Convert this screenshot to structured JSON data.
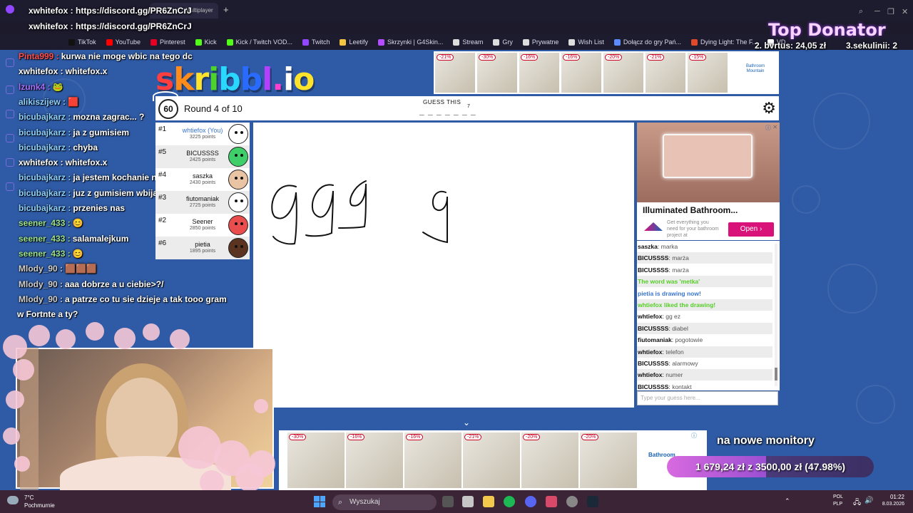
{
  "browser": {
    "tab_title": "Multiplayer",
    "url_overlay_1": "xwhitefox : https://discord.gg/PR6ZnCrJ",
    "url_overlay_2": "xwhitefox : https://discord.gg/PR6ZnCrJ",
    "bookmarks": [
      {
        "label": "TikTok",
        "color": "#111111"
      },
      {
        "label": "YouTube",
        "color": "#ff0000"
      },
      {
        "label": "Pinterest",
        "color": "#e60023"
      },
      {
        "label": "Kick",
        "color": "#53fc18"
      },
      {
        "label": "Kick / Twitch VOD...",
        "color": "#53fc18"
      },
      {
        "label": "Twitch",
        "color": "#9146ff"
      },
      {
        "label": "Leetify",
        "color": "#f5c542"
      },
      {
        "label": "Skrzynki | G4Skin...",
        "color": "#b44dff"
      },
      {
        "label": "Stream",
        "color": "#dddddd"
      },
      {
        "label": "Gry",
        "color": "#dddddd"
      },
      {
        "label": "Prywatne",
        "color": "#dddddd"
      },
      {
        "label": "Wish List",
        "color": "#dddddd"
      },
      {
        "label": "Dołącz do gry Pań...",
        "color": "#5b8cff"
      },
      {
        "label": "Dying Light: The F...",
        "color": "#e04a2a"
      },
      {
        "label": "VD",
        "color": "#ffffff"
      }
    ]
  },
  "stream_overlay": {
    "top_donator_title": "Top Donator",
    "donator_2": "2. bvrtus: 24,05 zł",
    "donator_3": "3.sekulinii: 2",
    "goal_text": "na nowe monitory",
    "goal_progress": "1 679,24 zł z 3500,00 zł (47.98%)",
    "goal_fraction": 0.4798
  },
  "twitch_chat": [
    {
      "user": "Pinta999",
      "user_color": "#ff4d4d",
      "msg": "kurwa nie moge wbic na tego dc"
    },
    {
      "user": "xwhitefox",
      "user_color": "#ffffff",
      "msg": "whitefox.x"
    },
    {
      "user": "lzunk4",
      "user_color": "#a970ff",
      "msg": "🐸"
    },
    {
      "user": "alikiszijew",
      "user_color": "#8fd3ff",
      "msg": "🟥"
    },
    {
      "user": "bicubajkarz",
      "user_color": "#8fd3ff",
      "msg": "mozna zagrac... ?"
    },
    {
      "user": "bicubajkarz",
      "user_color": "#8fd3ff",
      "msg": "ja z gumisiem"
    },
    {
      "user": "bicubajkarz",
      "user_color": "#8fd3ff",
      "msg": "chyba"
    },
    {
      "user": "xwhitefox",
      "user_color": "#ffffff",
      "msg": "whitefox.x"
    },
    {
      "user": "bicubajkarz",
      "user_color": "#8fd3ff",
      "msg": "ja jestem kochanie na dc"
    },
    {
      "user": "bicubajkarz",
      "user_color": "#8fd3ff",
      "msg": "juz z gumisiem wbijamy"
    },
    {
      "user": "bicubajkarz",
      "user_color": "#8fd3ff",
      "msg": "przenies nas"
    },
    {
      "user": "seener_433",
      "user_color": "#9be38c",
      "msg": "😊"
    },
    {
      "user": "seener_433",
      "user_color": "#9be38c",
      "msg": "salamalejkum"
    },
    {
      "user": "seener_433",
      "user_color": "#9be38c",
      "msg": "😊"
    },
    {
      "user": "Mlody_90",
      "user_color": "#cfcfcf",
      "msg": "🟫🟫🟫"
    },
    {
      "user": "Mlody_90",
      "user_color": "#cfcfcf",
      "msg": "aaa dobrze a u ciebie>?/"
    },
    {
      "user": "Mlody_90",
      "user_color": "#cfcfcf",
      "msg": "a patrze co tu sie dzieje a tak tooo gram"
    },
    {
      "user": "",
      "user_color": "#ffffff",
      "msg": "w Fortnte a ty?"
    }
  ],
  "game": {
    "logo": "skribbl.io",
    "timer": "60",
    "round_text": "Round 4 of 10",
    "guess_label": "GUESS THIS",
    "word_blank": "_ _ _ _ _ _ _",
    "word_length": "7",
    "players": [
      {
        "rank": "#1",
        "name": "whtiefox (You)",
        "points": "3225 points",
        "color": "#ffffff",
        "self": true
      },
      {
        "rank": "#5",
        "name": "BICUSSSS",
        "points": "2425 points",
        "color": "#3ecf6a",
        "self": false
      },
      {
        "rank": "#4",
        "name": "saszka",
        "points": "2430 points",
        "color": "#e8c3a4",
        "self": false
      },
      {
        "rank": "#3",
        "name": "fiutomaniak",
        "points": "2725 points",
        "color": "#ffffff",
        "self": false
      },
      {
        "rank": "#2",
        "name": "Seener",
        "points": "2850 points",
        "color": "#e94d4d",
        "self": false
      },
      {
        "rank": "#6",
        "name": "pietia",
        "points": "1895 points",
        "color": "#5a3420",
        "self": false
      }
    ],
    "chat": [
      {
        "user": "saszka",
        "msg": "marka",
        "color": "#111111",
        "system": false
      },
      {
        "user": "BICUSSSS",
        "msg": "marża",
        "color": "#111111",
        "system": false
      },
      {
        "user": "BICUSSSS",
        "msg": "marża",
        "color": "#111111",
        "system": false
      },
      {
        "user": "",
        "msg": "The word was 'metka'",
        "color": "#56ce27",
        "system": true
      },
      {
        "user": "",
        "msg": "pietia is drawing now!",
        "color": "#3975ce",
        "system": true
      },
      {
        "user": "",
        "msg": "whtiefox liked the drawing!",
        "color": "#56ce27",
        "system": true
      },
      {
        "user": "whtiefox",
        "msg": "gg ez",
        "color": "#111111",
        "system": false
      },
      {
        "user": "BICUSSSS",
        "msg": "diabel",
        "color": "#111111",
        "system": false
      },
      {
        "user": "fiutomaniak",
        "msg": "pogotowie",
        "color": "#111111",
        "system": false
      },
      {
        "user": "whtiefox",
        "msg": "telefon",
        "color": "#111111",
        "system": false
      },
      {
        "user": "BICUSSSS",
        "msg": "alarmowy",
        "color": "#111111",
        "system": false
      },
      {
        "user": "whtiefox",
        "msg": "numer",
        "color": "#111111",
        "system": false
      },
      {
        "user": "BICUSSSS",
        "msg": "kontakt",
        "color": "#111111",
        "system": false
      }
    ],
    "guess_placeholder": "Type your guess here..."
  },
  "ads": {
    "top_discounts": [
      "-21%",
      "-30%",
      "-16%",
      "-16%",
      "-20%",
      "-21%",
      "-15%"
    ],
    "top_brand": "Bathroom Mountain",
    "right_title": "Illuminated Bathroom...",
    "right_desc": "Get everything you need for your bathroom project at",
    "right_button": "Open",
    "bottom_discounts": [
      "-30%",
      "-16%",
      "-16%",
      "-21%",
      "-20%",
      "-20%"
    ],
    "bottom_brand": "Bathroom"
  },
  "taskbar": {
    "weather_temp": "7°C",
    "weather_desc": "Pochmurnie",
    "search": "Wyszukaj",
    "lang": "POL",
    "lang2": "PLP",
    "time": "01:22",
    "date": "8.03.2026"
  }
}
